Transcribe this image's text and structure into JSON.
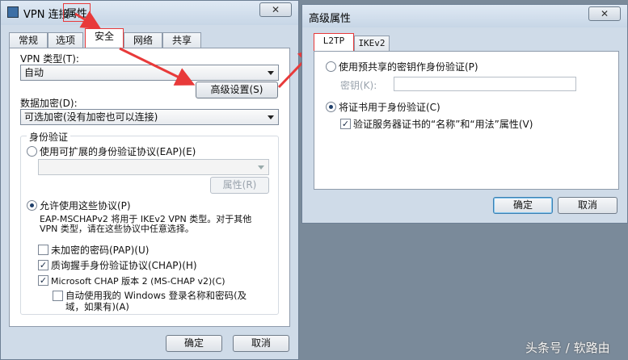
{
  "left_dialog": {
    "title_prefix": "VPN 连接",
    "title_highlight": "属性",
    "close_label": "✕",
    "tabs": [
      "常规",
      "选项",
      "安全",
      "网络",
      "共享"
    ],
    "vpn_type_label": "VPN 类型(T):",
    "vpn_type_value": "自动",
    "advanced_button": "高级设置(S)",
    "encryption_label": "数据加密(D):",
    "encryption_value": "可选加密(没有加密也可以连接)",
    "auth_group": "身份验证",
    "eap_radio": "使用可扩展的身份验证协议(EAP)(E)",
    "properties_button": "属性(R)",
    "allow_radio": "允许使用这些协议(P)",
    "allow_note_1": "EAP-MSCHAPv2 将用于 IKEv2 VPN 类型。对于其他",
    "allow_note_2": "VPN 类型，请在这些协议中任意选择。",
    "pap_check": "未加密的密码(PAP)(U)",
    "chap_check": "质询握手身份验证协议(CHAP)(H)",
    "mschap_check": "Microsoft CHAP 版本 2 (MS-CHAP v2)(C)",
    "auto_windows_line1": "自动使用我的 Windows 登录名称和密码(及",
    "auto_windows_line2": "域，如果有)(A)",
    "ok_button": "确定",
    "cancel_button": "取消"
  },
  "right_dialog": {
    "title": "高级属性",
    "close_label": "✕",
    "tabs": [
      "L2TP",
      "IKEv2"
    ],
    "psk_radio": "使用预共享的密钥作身份验证(P)",
    "key_label": "密钥(K):",
    "cert_radio": "将证书用于身份验证(C)",
    "verify_check": "验证服务器证书的“名称”和“用法”属性(V)",
    "ok_button": "确定",
    "cancel_button": "取消"
  },
  "watermark": "头条号 / 软路由",
  "colors": {
    "annotation_red": "#e83a3a",
    "dialog_bg": "#cfdbe8"
  }
}
